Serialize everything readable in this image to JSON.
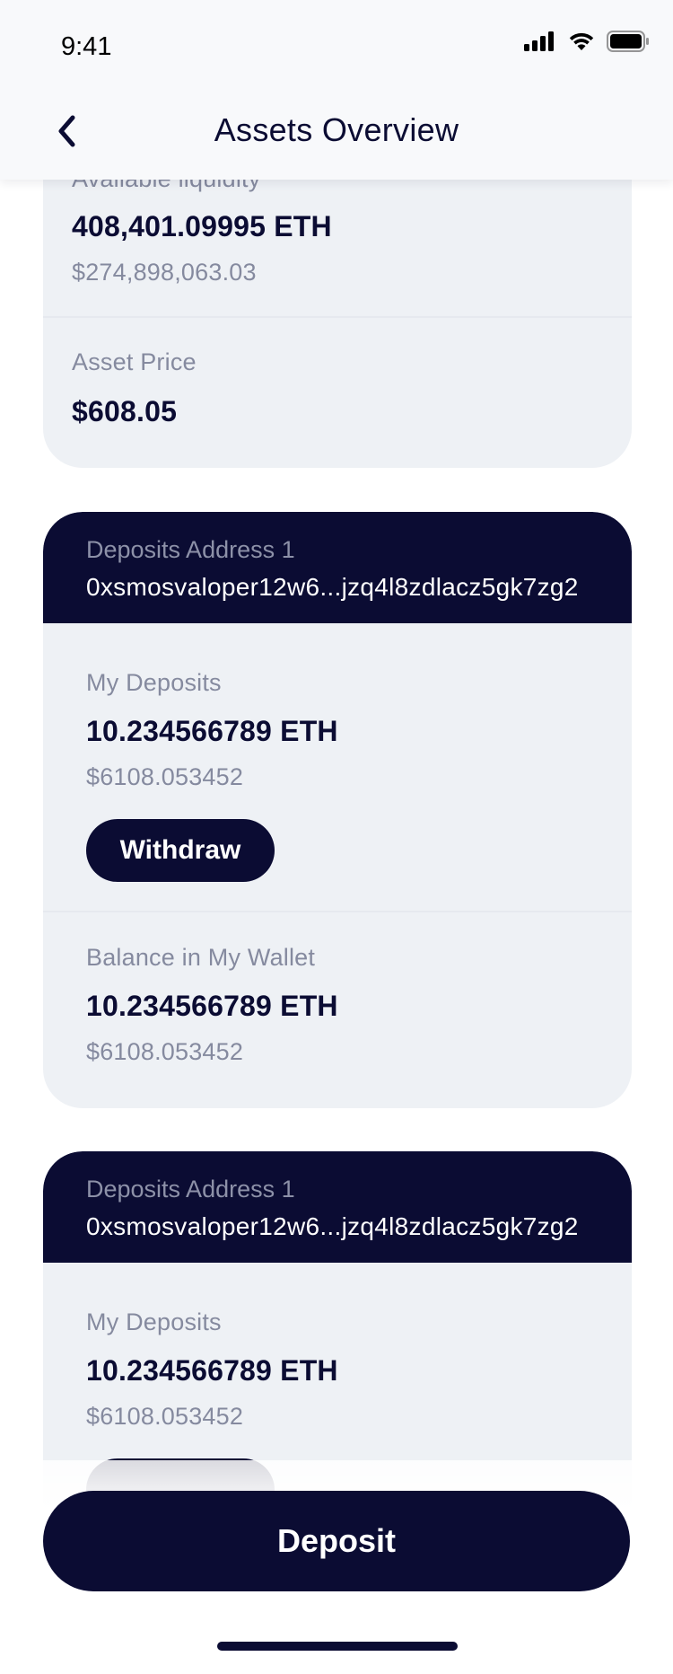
{
  "status_bar": {
    "time": "9:41"
  },
  "header": {
    "title": "Assets Overview"
  },
  "summary": {
    "liquidity_label": "Available liquidity",
    "liquidity_value": "408,401.09995 ETH",
    "liquidity_usd": "$274,898,063.03",
    "price_label": "Asset Price",
    "price_value": "$608.05"
  },
  "accounts": [
    {
      "address_label": "Deposits Address 1",
      "address": "0xsmosvaloper12w6...jzq4l8zdlacz5gk7zg2",
      "deposits_label": "My Deposits",
      "deposits_value": "10.234566789 ETH",
      "deposits_usd": "$6108.053452",
      "withdraw_label": "Withdraw",
      "wallet_label": "Balance in My Wallet",
      "wallet_value": "10.234566789 ETH",
      "wallet_usd": "$6108.053452"
    },
    {
      "address_label": "Deposits Address 1",
      "address": "0xsmosvaloper12w6...jzq4l8zdlacz5gk7zg2",
      "deposits_label": "My Deposits",
      "deposits_value": "10.234566789 ETH",
      "deposits_usd": "$6108.053452"
    }
  ],
  "footer": {
    "deposit_label": "Deposit"
  },
  "colors": {
    "navy": "#0b0c33",
    "card_bg": "#eef1f5",
    "muted": "#858a9f"
  }
}
